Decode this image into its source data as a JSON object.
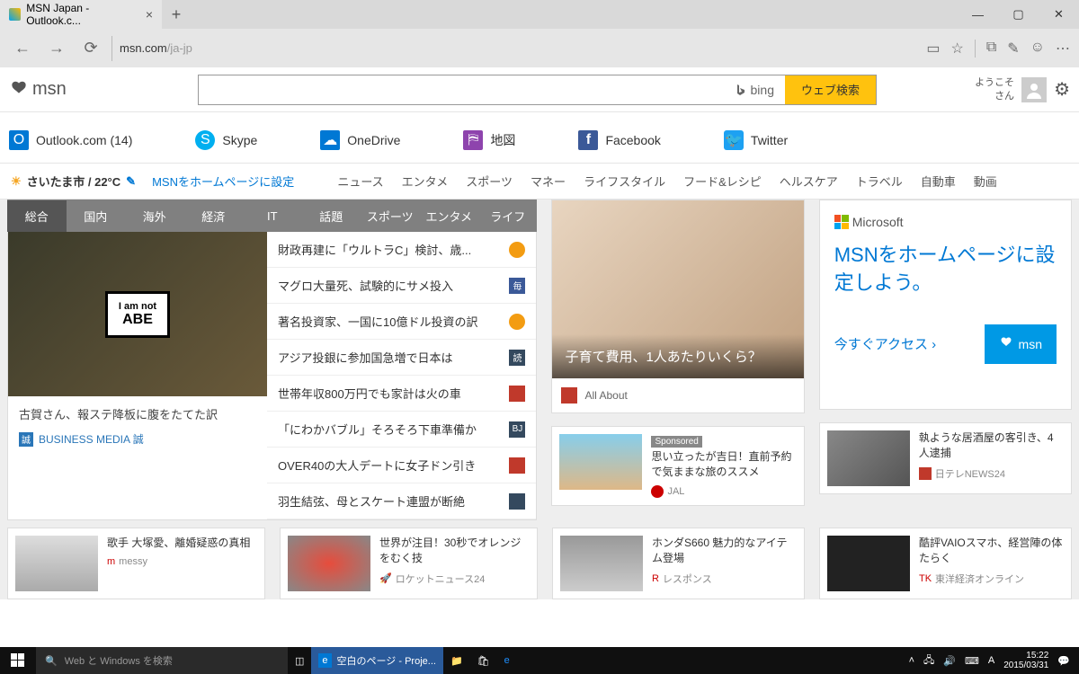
{
  "browser": {
    "tab_title": "MSN Japan - Outlook.c...",
    "url_host": "msn.com",
    "url_path": "/ja-jp"
  },
  "header": {
    "logo": "msn",
    "bing_label": "bing",
    "search_btn": "ウェブ検索",
    "welcome1": "ようこそ",
    "welcome2": "さん"
  },
  "quick_links": [
    {
      "label": "Outlook.com (14)",
      "icon": "outlook"
    },
    {
      "label": "Skype",
      "icon": "skype"
    },
    {
      "label": "OneDrive",
      "icon": "onedrive"
    },
    {
      "label": "地図",
      "icon": "maps"
    },
    {
      "label": "Facebook",
      "icon": "fb"
    },
    {
      "label": "Twitter",
      "icon": "tw"
    }
  ],
  "info_bar": {
    "location": "さいたま市 / 22°C",
    "homepage_link": "MSNをホームページに設定",
    "categories": [
      "ニュース",
      "エンタメ",
      "スポーツ",
      "マネー",
      "ライフスタイル",
      "フード&レシピ",
      "ヘルスケア",
      "トラベル",
      "自動車",
      "動画"
    ]
  },
  "news_tabs": [
    "総合",
    "国内",
    "海外",
    "経済",
    "IT",
    "話題",
    "スポーツ",
    "エンタメ",
    "ライフ"
  ],
  "hero": {
    "sign_line1": "I am not",
    "sign_line2": "ABE",
    "caption": "古賀さん、報ステ降板に腹をたてた訳",
    "source": "BUSINESS MEDIA 誠",
    "source_badge": "誠"
  },
  "headlines": [
    {
      "text": "財政再建に「ウルトラC」検討、歳...",
      "badge": "b-orange"
    },
    {
      "text": "マグロ大量死、試験的にサメ投入",
      "badge": "b-blue",
      "badge_text": "毎"
    },
    {
      "text": "著名投資家、一国に10億ドル投資の訳",
      "badge": "b-orange"
    },
    {
      "text": "アジア投銀に参加国急増で日本は",
      "badge": "b-gray",
      "badge_text": "読"
    },
    {
      "text": "世帯年収800万円でも家計は火の車",
      "badge": "b-red"
    },
    {
      "text": "「にわかバブル」そろそろ下車準備か",
      "badge": "b-gray",
      "badge_text": "BJ"
    },
    {
      "text": "OVER40の大人デートに女子ドン引き",
      "badge": "b-red"
    },
    {
      "text": "羽生結弦、母とスケート連盟が断絶",
      "badge": "b-gray"
    }
  ],
  "feature": {
    "title": "子育て費用、1人あたりいくら？",
    "source": "All About"
  },
  "promo": {
    "ms": "Microsoft",
    "title": "MSNをホームページに設定しよう。",
    "cta": "今すぐアクセス  ›",
    "btn": "msn"
  },
  "mid_cards": [
    {
      "sponsored": "Sponsored",
      "title": "思い立ったが吉日！直前予約で気ままな旅のススメ",
      "source": "JAL"
    },
    {
      "title": "執ような居酒屋の客引き、4人逮捕",
      "source": "日テレNEWS24"
    }
  ],
  "bottom_cards": [
    {
      "title": "歌手 大塚愛、離婚疑惑の真相",
      "source": "messy",
      "badge": "m"
    },
    {
      "title": "世界が注目！30秒でオレンジをむく技",
      "source": "ロケットニュース24",
      "badge": "🚀"
    },
    {
      "title": "ホンダS660 魅力的なアイテム登場",
      "source": "レスポンス",
      "badge": "R"
    },
    {
      "title": "酷評VAIOスマホ、経営陣の体たらく",
      "source": "東洋経済オンライン",
      "badge": "TK"
    }
  ],
  "taskbar": {
    "search_placeholder": "Web と Windows を検索",
    "app1": "空白のページ - Proje...",
    "ime": "A",
    "time": "15:22",
    "date": "2015/03/31"
  }
}
